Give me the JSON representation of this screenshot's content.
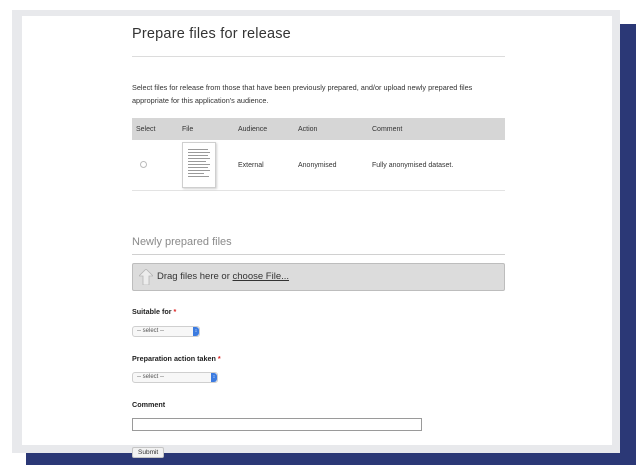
{
  "page": {
    "title": "Prepare files for release",
    "intro": "Select files for release from those that have been previously prepared, and/or upload newly prepared files appropriate for this application's audience."
  },
  "files_table": {
    "headers": [
      "Select",
      "File",
      "Audience",
      "Action",
      "Comment"
    ],
    "rows": [
      {
        "audience": "External",
        "action": "Anonymised",
        "comment": "Fully anonymised dataset."
      }
    ]
  },
  "new_files": {
    "section_title": "Newly prepared files",
    "drop_text": "Drag files here or ",
    "choose_link": "choose File..."
  },
  "form": {
    "suitable_for": {
      "label": "Suitable for",
      "required_mark": "*",
      "value": "-- select --"
    },
    "preparation_action": {
      "label": "Preparation action taken",
      "required_mark": "*",
      "value": "-- select --"
    },
    "comment": {
      "label": "Comment",
      "value": ""
    },
    "submit_label": "Submit"
  },
  "colors": {
    "frame_shadow": "#2b3876",
    "frame_border": "#e8e9ec",
    "table_header_bg": "#d6d6d6",
    "required": "#dd2222",
    "select_arrow": "#3c7be0"
  },
  "icons": {
    "upload": "upload-arrow-icon",
    "document": "document-thumbnail-icon",
    "select_arrows": "chevron-updown-icon"
  }
}
